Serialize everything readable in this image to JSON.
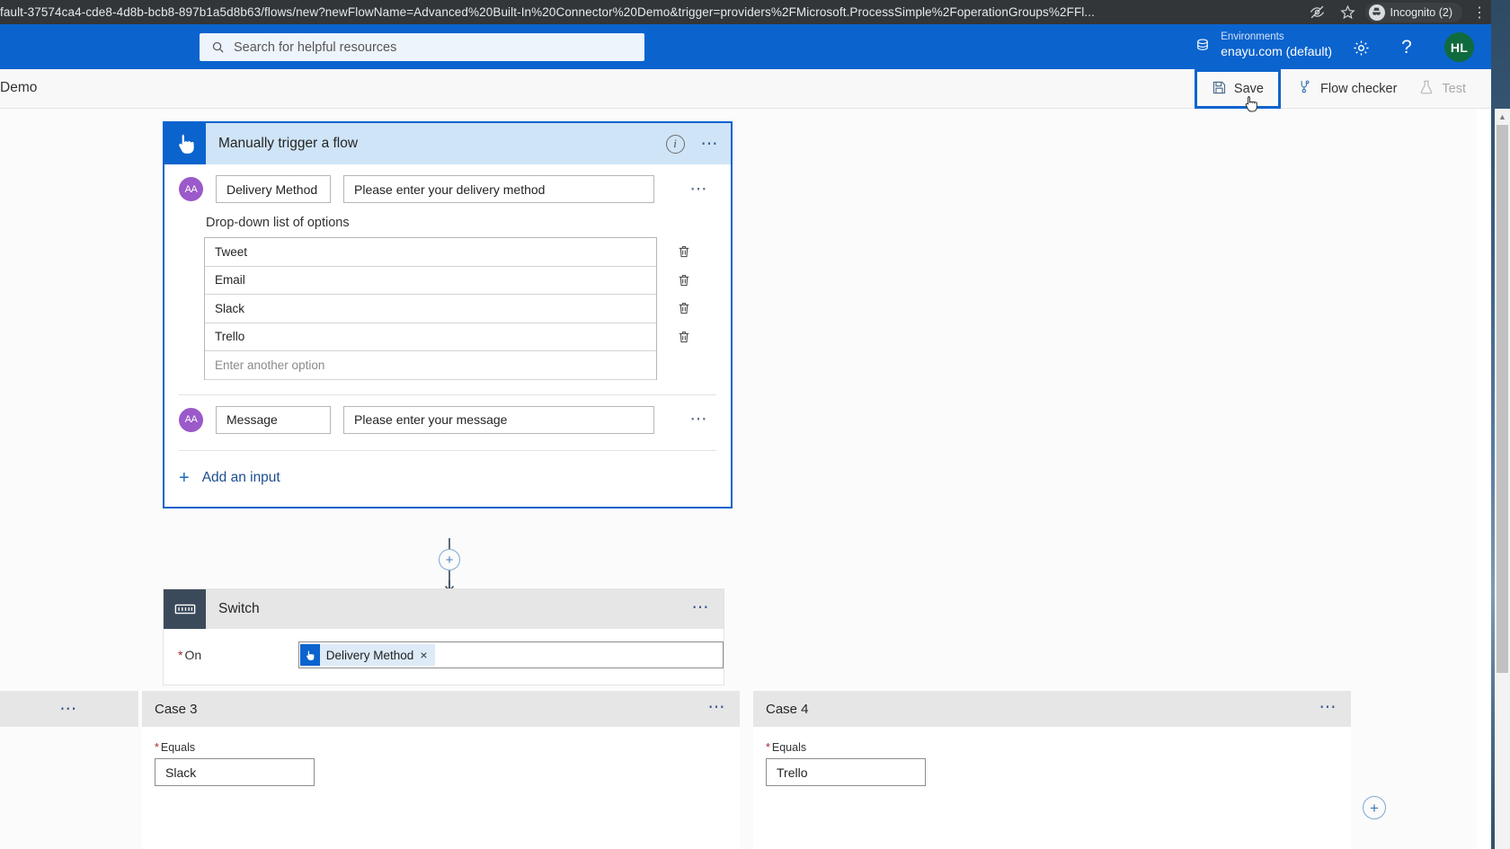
{
  "browser": {
    "url": "fault-37574ca4-cde8-4d8b-bcb8-897b1a5d8b63/flows/new?newFlowName=Advanced%20Built-In%20Connector%20Demo&trigger=providers%2FMicrosoft.ProcessSimple%2FoperationGroups%2FFl...",
    "eye_icon": "eye-slash-icon",
    "star_icon": "star-icon",
    "incognito_label": "Incognito (2)",
    "menu_icon": "kebab-menu-icon"
  },
  "header": {
    "search_placeholder": "Search for helpful resources",
    "environments_label": "Environments",
    "environment_value": "enayu.com (default)",
    "settings_icon": "gear-icon",
    "help_icon": "question-mark-icon",
    "avatar_initials": "HL",
    "brand_color": "#0b63ce"
  },
  "command_bar": {
    "flow_name": "Demo",
    "save_label": "Save",
    "flow_checker_label": "Flow checker",
    "test_label": "Test",
    "test_disabled": true,
    "focus_outline_color": "#0b63ce"
  },
  "trigger": {
    "title": "Manually trigger a flow",
    "inputs": [
      {
        "name": "Delivery Method",
        "value": "Please enter your delivery method"
      },
      {
        "name": "Message",
        "value": "Please enter your message"
      }
    ],
    "dropdown_label": "Drop-down list of options",
    "options": [
      "Tweet",
      "Email",
      "Slack",
      "Trello"
    ],
    "new_option_placeholder": "Enter another option",
    "add_input_label": "Add an input",
    "selected_border_color": "#0b63ce",
    "header_bg": "#cfe4f7"
  },
  "switch": {
    "title": "Switch",
    "on_label": "On",
    "on_required": "*",
    "token_label": "Delivery Method",
    "token_remove": "×"
  },
  "cases": [
    {
      "title": "Case 3",
      "equals_label": "Equals",
      "equals_required": "*",
      "equals_value": "Slack"
    },
    {
      "title": "Case 4",
      "equals_label": "Equals",
      "equals_required": "*",
      "equals_value": "Trello"
    }
  ],
  "canvas": {
    "add_step_glyph": "+",
    "add_case_glyph": "+"
  }
}
